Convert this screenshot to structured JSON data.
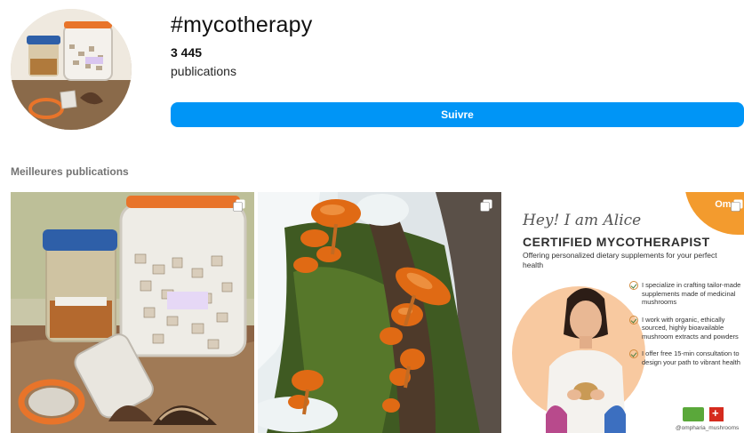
{
  "header": {
    "hashtag": "#mycotherapy",
    "post_count": "3 445",
    "post_count_label": "publications",
    "follow_label": "Suivre"
  },
  "top_posts": {
    "title": "Meilleures publications",
    "posts": [
      {
        "kind": "photo-mushroom-jars",
        "multi": true
      },
      {
        "kind": "photo-orange-mushrooms",
        "multi": true
      },
      {
        "kind": "poster",
        "multi": true,
        "brand": "Omph",
        "greeting": "Hey! I am Alice",
        "headline": "CERTIFIED MYCOTHERAPIST",
        "subtitle": "Offering personalized dietary supplements for your perfect health",
        "bullets": [
          "I specialize in crafting tailor-made supplements made of medicinal mushrooms",
          "I work with organic, ethically sourced, highly bioavailable mushroom extracts and powders",
          "I offer free 15-min consultation to design your path to vibrant health"
        ],
        "handle": "@ompharia_mushrooms"
      }
    ]
  },
  "colors": {
    "accent": "#0095f6",
    "poster_orange": "#f39b2e"
  },
  "icons": {
    "multi": "carousel-icon"
  }
}
